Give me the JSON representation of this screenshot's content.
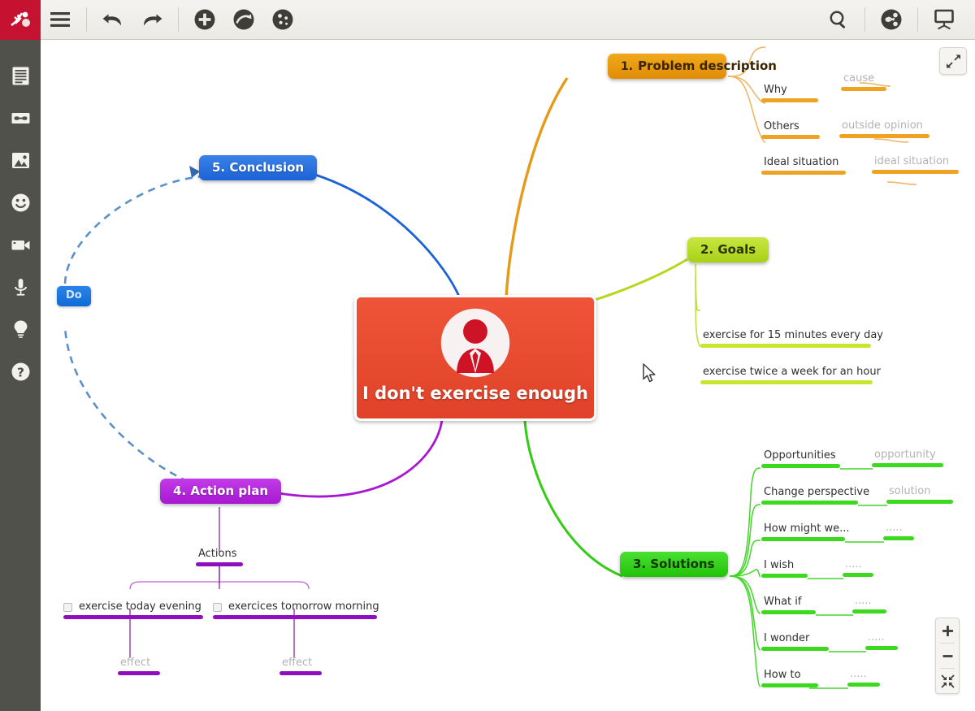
{
  "toolbar": {
    "logo_icon": "mindmap-logo-icon",
    "menu_label": "Menu",
    "undo_label": "Undo",
    "redo_label": "Redo",
    "add_label": "Add node",
    "add_relation_label": "Add relationship",
    "style_label": "Style / theme",
    "search_label": "Search",
    "share_label": "Share",
    "present_label": "Presentation mode"
  },
  "sidebar": {
    "items": [
      {
        "label": "Note",
        "icon": "note-icon"
      },
      {
        "label": "Link",
        "icon": "link-icon"
      },
      {
        "label": "Image",
        "icon": "image-icon"
      },
      {
        "label": "Emoji",
        "icon": "smiley-icon"
      },
      {
        "label": "Video",
        "icon": "video-icon"
      },
      {
        "label": "Audio",
        "icon": "microphone-icon"
      },
      {
        "label": "Idea",
        "icon": "lightbulb-icon"
      },
      {
        "label": "Help",
        "icon": "question-mark-icon"
      }
    ]
  },
  "canvas": {
    "expand_label": "Expand",
    "zoom_in_label": "+",
    "zoom_out_label": "−",
    "fit_label": "Fit to screen"
  },
  "map": {
    "root": {
      "label": "I don't exercise enough",
      "color": "#e8492a",
      "icon": "person-avatar-icon"
    },
    "relationship": {
      "label": "Do",
      "from": "4. Action plan",
      "to": "5. Conclusion",
      "color": "#1a62d6"
    },
    "branches": [
      {
        "number": "1.",
        "title": "Problem description",
        "color": "#e89208",
        "children": [
          {
            "label": "Why",
            "value": "cause"
          },
          {
            "label": "Others",
            "value": "outside opinion"
          },
          {
            "label": "Ideal situation",
            "value": "ideal situation"
          }
        ]
      },
      {
        "number": "2.",
        "title": "Goals",
        "color": "#b4d81c",
        "children": [
          {
            "label": "exercise for 15 minutes every day",
            "value": ""
          },
          {
            "label": "exercise twice a week for an hour",
            "value": ""
          }
        ]
      },
      {
        "number": "3.",
        "title": "Solutions",
        "color": "#2ecc0f",
        "children": [
          {
            "label": "Opportunities",
            "value": "opportunity"
          },
          {
            "label": "Change perspective",
            "value": "solution"
          },
          {
            "label": "How might we...",
            "value": "....."
          },
          {
            "label": "I wish",
            "value": "....."
          },
          {
            "label": "What if",
            "value": "....."
          },
          {
            "label": "I wonder",
            "value": "....."
          },
          {
            "label": "How to",
            "value": "....."
          }
        ]
      },
      {
        "number": "4.",
        "title": "Action plan",
        "color": "#ab1ad1",
        "children": [
          {
            "label": "Actions",
            "value": ""
          },
          {
            "label": "exercise today evening",
            "value": "effect",
            "checkbox": true
          },
          {
            "label": "exercices tomorrow morning",
            "value": "effect",
            "checkbox": true
          }
        ]
      },
      {
        "number": "5.",
        "title": "Conclusion",
        "color": "#1a62d6",
        "children": []
      }
    ],
    "nodes": {
      "problem_title": "Problem description",
      "problem_num": "1.",
      "goals_title": "2. Goals",
      "solutions_title": "3. Solutions",
      "action_title": "4. Action plan",
      "conclusion_title": "5. Conclusion"
    },
    "leaves": {
      "why": "Why",
      "cause": "cause",
      "others": "Others",
      "outside_opinion": "outside opinion",
      "ideal_situation": "Ideal situation",
      "ideal_situation_val": "ideal situation",
      "goal1": "exercise for 15 minutes every day",
      "goal2": "exercise twice a week for an hour",
      "opportunities": "Opportunities",
      "opportunity": "opportunity",
      "change_perspective": "Change perspective",
      "solution": "solution",
      "how_might_we": "How might we...",
      "i_wish": "I wish",
      "what_if": "What if",
      "i_wonder": "I wonder",
      "how_to": "How to",
      "dots": ".....",
      "actions": "Actions",
      "task1": "exercise today evening",
      "task2": "exercices tomorrow morning",
      "effect": "effect"
    }
  }
}
